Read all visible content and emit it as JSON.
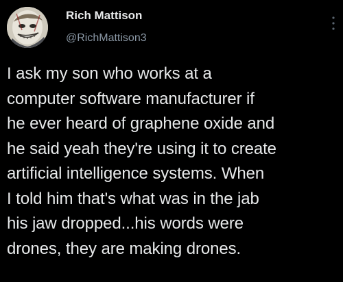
{
  "author": {
    "name": "Rich Mattison",
    "handle": "@RichMattison3",
    "avatar": "avatar-image"
  },
  "menu": {
    "icon": "more-vertical-icon"
  },
  "tweet": {
    "text": "I ask my son who works at a\ncomputer software manufacturer if\nhe ever heard of graphene oxide and\nhe said yeah they're using it to create\nartificial intelligence systems.  When\nI told him that's what was in the jab\nhis jaw dropped...his words were\ndrones, they are making drones."
  },
  "colors": {
    "background": "#000000",
    "text": "#e7e9ea",
    "secondary_text": "#8b98a5"
  }
}
